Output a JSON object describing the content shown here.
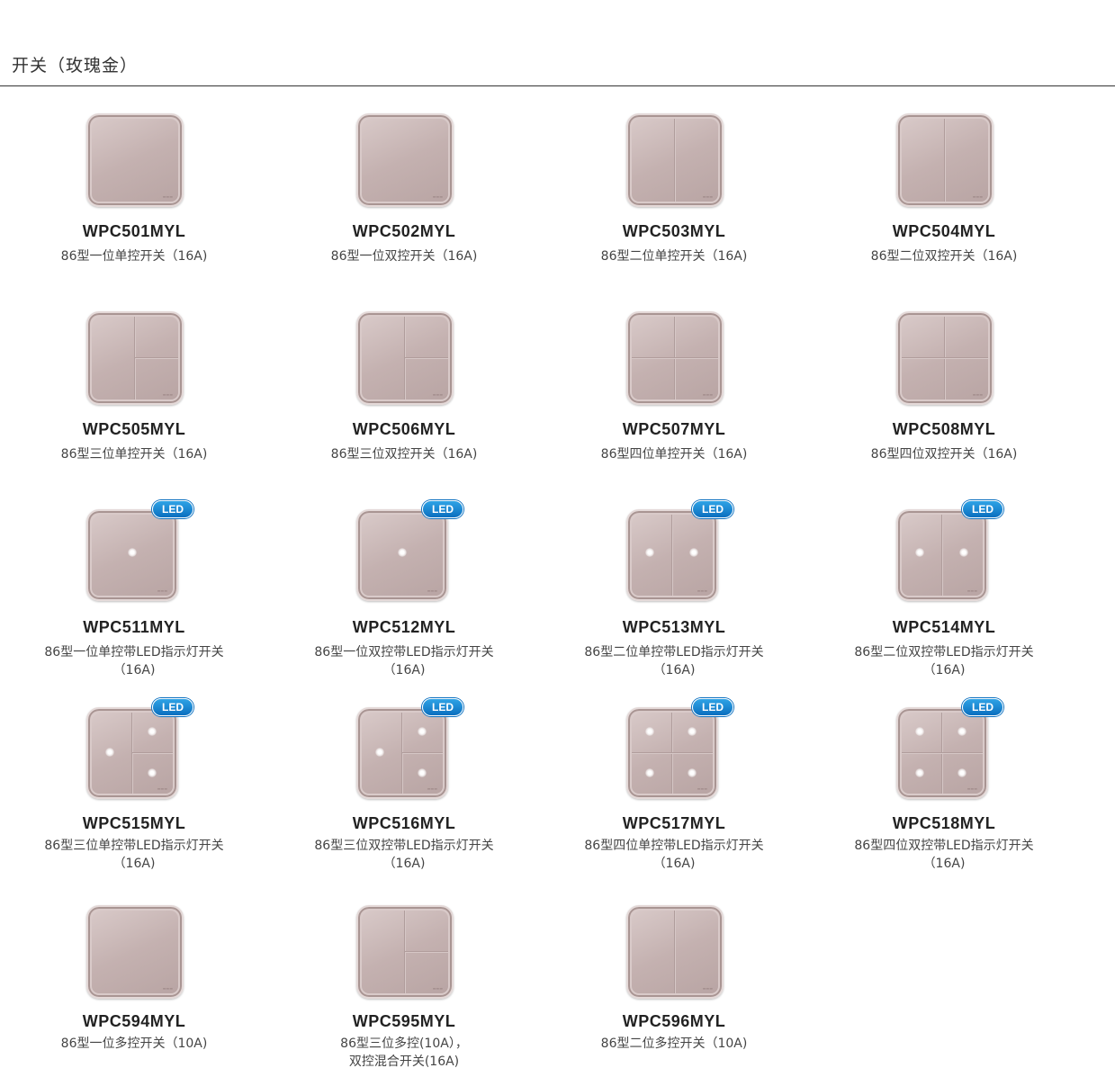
{
  "section_title": "开关（玫瑰金）",
  "led_badge": "LED",
  "colors": {
    "plate": "#c4b1b0",
    "led_badge": "#1a86d3",
    "rule": "#333333"
  },
  "products": [
    {
      "model": "WPC501MYL",
      "desc1": "86型一位单控开关（16A)",
      "desc2": ""
    },
    {
      "model": "WPC502MYL",
      "desc1": "86型一位双控开关（16A)",
      "desc2": ""
    },
    {
      "model": "WPC503MYL",
      "desc1": "86型二位单控开关（16A)",
      "desc2": ""
    },
    {
      "model": "WPC504MYL",
      "desc1": "86型二位双控开关（16A)",
      "desc2": ""
    },
    {
      "model": "WPC505MYL",
      "desc1": "86型三位单控开关（16A)",
      "desc2": ""
    },
    {
      "model": "WPC506MYL",
      "desc1": "86型三位双控开关（16A)",
      "desc2": ""
    },
    {
      "model": "WPC507MYL",
      "desc1": "86型四位单控开关（16A)",
      "desc2": ""
    },
    {
      "model": "WPC508MYL",
      "desc1": "86型四位双控开关（16A)",
      "desc2": ""
    },
    {
      "model": "WPC511MYL",
      "desc1": "86型一位单控带LED指示灯开关",
      "desc2": "（16A)"
    },
    {
      "model": "WPC512MYL",
      "desc1": "86型一位双控带LED指示灯开关",
      "desc2": "（16A)"
    },
    {
      "model": "WPC513MYL",
      "desc1": "86型二位单控带LED指示灯开关",
      "desc2": "（16A)"
    },
    {
      "model": "WPC514MYL",
      "desc1": "86型二位双控带LED指示灯开关",
      "desc2": "（16A)"
    },
    {
      "model": "WPC515MYL",
      "desc1": "86型三位单控带LED指示灯开关",
      "desc2": "（16A)"
    },
    {
      "model": "WPC516MYL",
      "desc1": "86型三位双控带LED指示灯开关",
      "desc2": "（16A)"
    },
    {
      "model": "WPC517MYL",
      "desc1": "86型四位单控带LED指示灯开关",
      "desc2": "（16A)"
    },
    {
      "model": "WPC518MYL",
      "desc1": "86型四位双控带LED指示灯开关",
      "desc2": "（16A)"
    },
    {
      "model": "WPC594MYL",
      "desc1": "86型一位多控开关（10A)",
      "desc2": ""
    },
    {
      "model": "WPC595MYL",
      "desc1": "86型三位多控(10A），",
      "desc2": "双控混合开关(16A)"
    },
    {
      "model": "WPC596MYL",
      "desc1": "86型二位多控开关（10A)",
      "desc2": ""
    }
  ]
}
